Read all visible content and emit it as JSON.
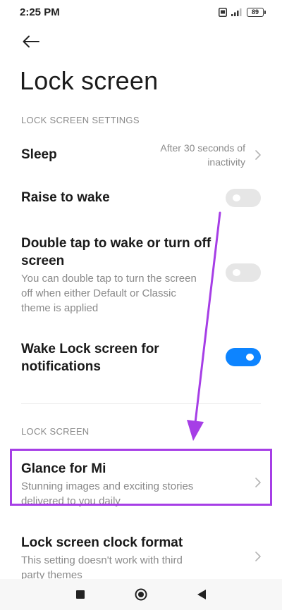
{
  "status_bar": {
    "time": "2:25 PM",
    "battery": "89"
  },
  "header": {
    "title": "Lock screen"
  },
  "sections": {
    "lock_screen_settings": "LOCK SCREEN SETTINGS",
    "lock_screen": "LOCK SCREEN"
  },
  "settings": {
    "sleep": {
      "title": "Sleep",
      "value_line1": "After 30 seconds of",
      "value_line2": "inactivity"
    },
    "raise_to_wake": {
      "title": "Raise to wake",
      "enabled": false
    },
    "double_tap": {
      "title_line1": "Double tap to wake or turn off",
      "title_line2": "screen",
      "desc_line1": "You can double tap to turn the screen",
      "desc_line2": "off when either Default or Classic",
      "desc_line3": "theme is applied",
      "enabled": false
    },
    "wake_lock_notifications": {
      "title_line1": "Wake Lock screen for",
      "title_line2": "notifications",
      "enabled": true
    },
    "glance": {
      "title": "Glance for Mi",
      "desc_line1": "Stunning images and exciting stories",
      "desc_line2": "delivered to you daily"
    },
    "clock_format": {
      "title": "Lock screen clock format",
      "desc_line1": "This setting doesn't work with third",
      "desc_line2": "party themes"
    }
  },
  "colors": {
    "accent_toggle": "#0d84ff",
    "highlight": "#a63ee6"
  },
  "icons": {
    "back": "arrow-left-icon",
    "nav_recents": "square-icon",
    "nav_home": "circle-icon",
    "nav_back": "triangle-back-icon"
  }
}
